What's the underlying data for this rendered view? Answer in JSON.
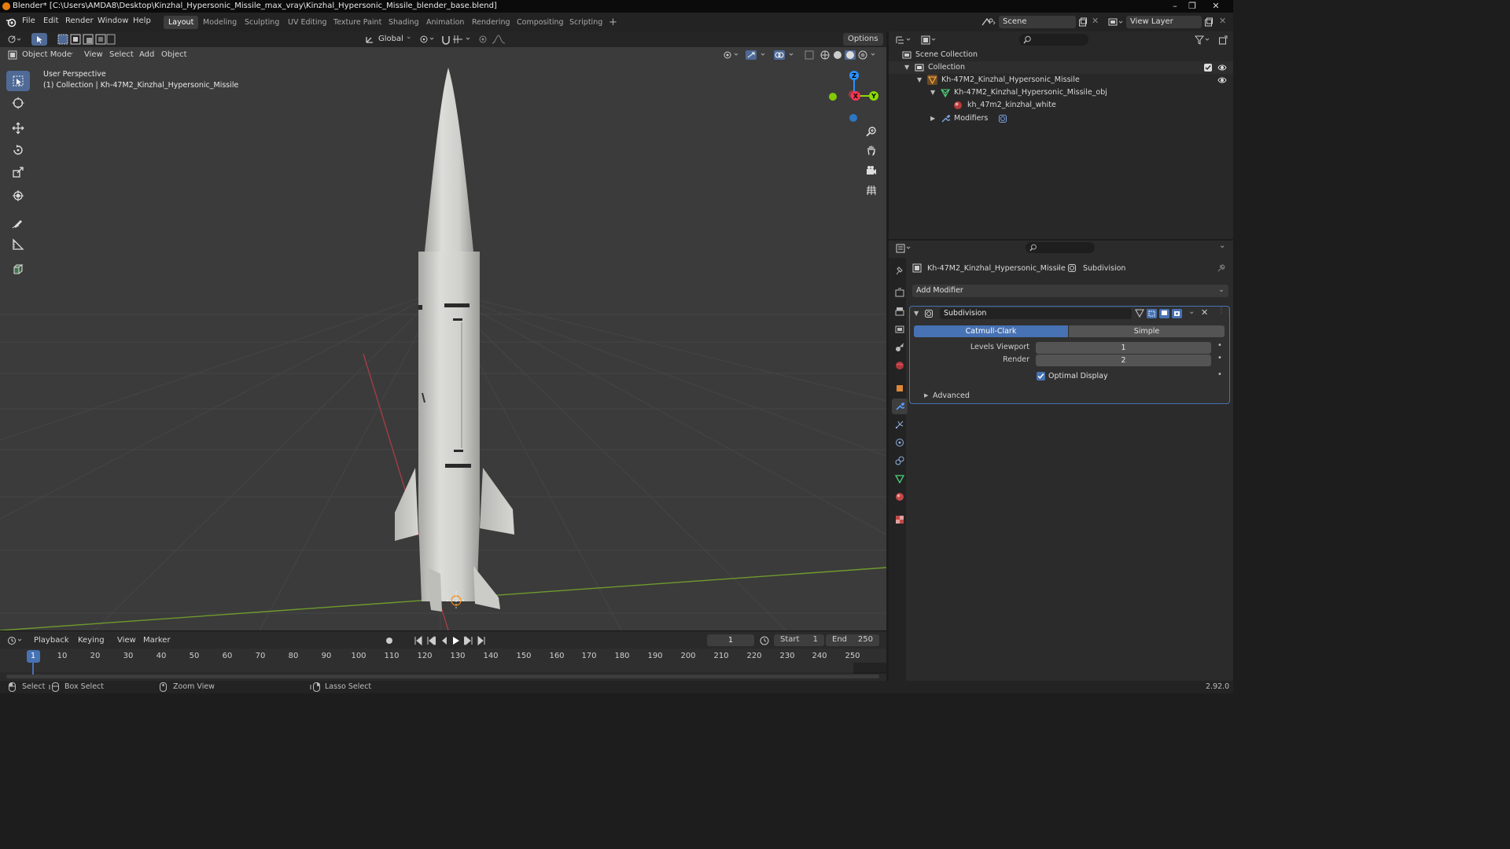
{
  "window": {
    "title": "Blender* [C:\\Users\\AMDA8\\Desktop\\Kinzhal_Hypersonic_Missile_max_vray\\Kinzhal_Hypersonic_Missile_blender_base.blend]"
  },
  "menu": {
    "items": [
      "File",
      "Edit",
      "Render",
      "Window",
      "Help"
    ]
  },
  "workspaces": {
    "tabs": [
      "Layout",
      "Modeling",
      "Sculpting",
      "UV Editing",
      "Texture Paint",
      "Shading",
      "Animation",
      "Rendering",
      "Compositing",
      "Scripting"
    ],
    "active": "Layout",
    "add": "+"
  },
  "scene": {
    "name": "Scene",
    "view_layer": "View Layer"
  },
  "viewport": {
    "mode": "Object Mode",
    "menus": [
      "View",
      "Select",
      "Add",
      "Object"
    ],
    "orientation": "Global",
    "options": "Options",
    "perspective": "User Perspective",
    "collection_info": "(1) Collection | Kh-47M2_Kinzhal_Hypersonic_Missile",
    "gizmo": {
      "x": "X",
      "y": "Y",
      "z": "Z"
    }
  },
  "timeline": {
    "menus": [
      "Playback",
      "Keying",
      "View",
      "Marker"
    ],
    "current_frame": "1",
    "start_label": "Start",
    "start": "1",
    "end_label": "End",
    "end": "250",
    "ticks": [
      "1",
      "10",
      "20",
      "30",
      "40",
      "50",
      "60",
      "70",
      "80",
      "90",
      "100",
      "110",
      "120",
      "130",
      "140",
      "150",
      "160",
      "170",
      "180",
      "190",
      "200",
      "210",
      "220",
      "230",
      "240",
      "250"
    ]
  },
  "outliner": {
    "root": "Scene Collection",
    "collection": "Collection",
    "object": "Kh-47M2_Kinzhal_Hypersonic_Missile",
    "mesh": "Kh-47M2_Kinzhal_Hypersonic_Missile_obj",
    "material": "kh_47m2_kinzhal_white",
    "modifiers": "Modifiers"
  },
  "properties": {
    "object_name": "Kh-47M2_Kinzhal_Hypersonic_Missile",
    "modifier_tab": "Subdivision",
    "add_modifier": "Add Modifier",
    "modifier": {
      "name": "Subdivision",
      "types": [
        "Catmull-Clark",
        "Simple"
      ],
      "active_type": "Catmull-Clark",
      "levels_viewport_label": "Levels Viewport",
      "levels_viewport": "1",
      "render_label": "Render",
      "render": "2",
      "optimal_display_label": "Optimal Display",
      "optimal_display": true,
      "advanced": "Advanced"
    }
  },
  "statusbar": {
    "select": "Select",
    "box_select": "Box Select",
    "zoom_view": "Zoom View",
    "lasso_select": "Lasso Select",
    "version": "2.92.0"
  },
  "colors": {
    "accent": "#4772b3",
    "axis_x": "#ff3352",
    "axis_y": "#8bdc00",
    "axis_z": "#2890ff",
    "blender_orange": "#e87d0d"
  }
}
